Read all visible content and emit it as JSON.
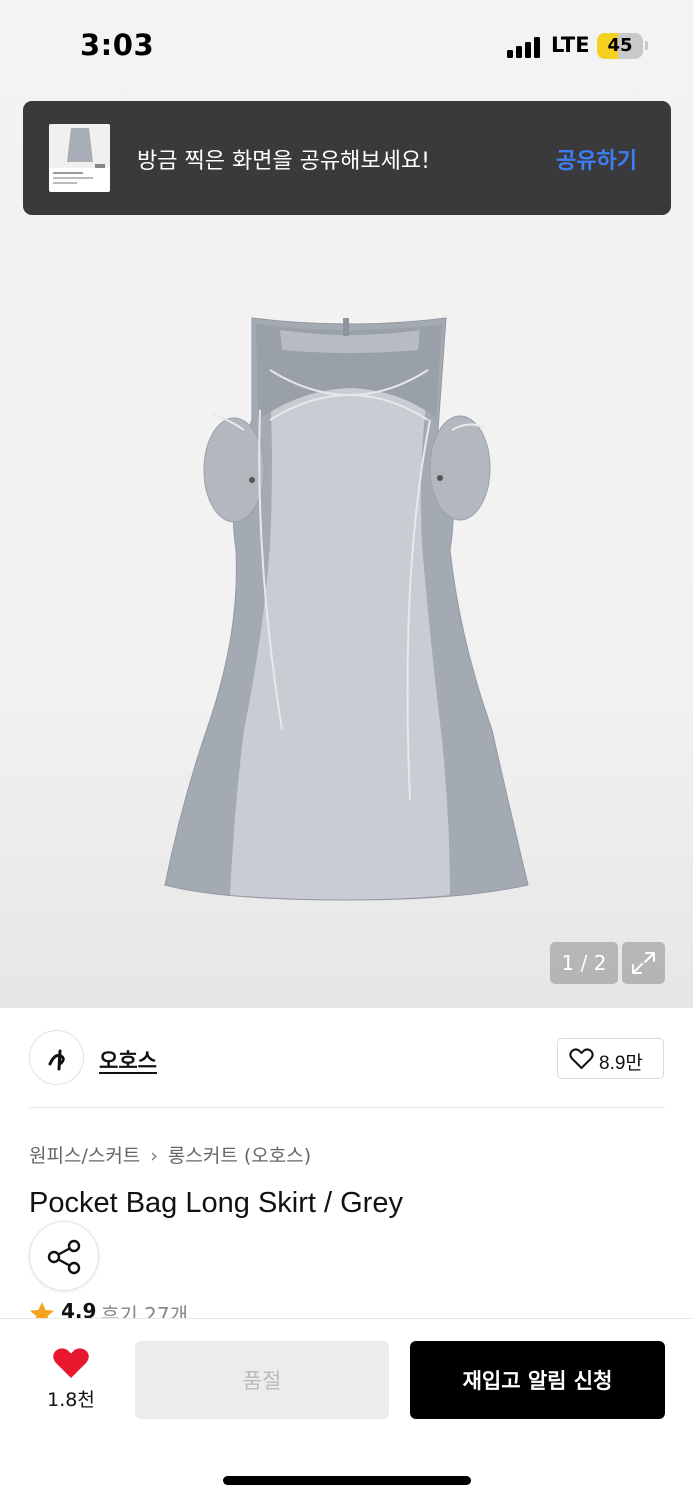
{
  "status_bar": {
    "time": "3:03",
    "network": "LTE",
    "battery": "45",
    "battery_fraction": 0.45
  },
  "toast": {
    "message": "방금 찍은 화면을 공유해보세요!",
    "action": "공유하기"
  },
  "gallery": {
    "pager": "1 / 2"
  },
  "brand": {
    "name": "오호스",
    "likes": "8.9만"
  },
  "product": {
    "breadcrumb": [
      "원피스/스커트",
      "롱스커트 (오호스)"
    ],
    "title": "Pocket Bag Long Skirt / Grey",
    "rating": "4.9",
    "review_count": "후기 27개"
  },
  "bottom_bar": {
    "wish_count": "1.8천",
    "soldout_label": "품절",
    "restock_label": "재입고 알림 신청"
  },
  "colors": {
    "accent_blue": "#3d7ef5",
    "heart_red": "#e8172e",
    "star_orange": "#f4a31a",
    "toast_bg": "#3a3a3c"
  }
}
